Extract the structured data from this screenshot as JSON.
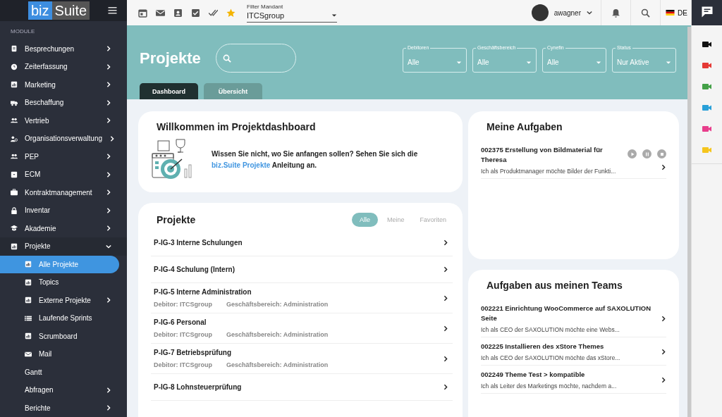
{
  "logo": {
    "part1": "biz",
    "part2": "Suite"
  },
  "sidebar": {
    "section": "MODULE",
    "items": [
      {
        "label": "Besprechungen",
        "expanded": false
      },
      {
        "label": "Zeiterfassung",
        "expanded": false
      },
      {
        "label": "Marketing",
        "expanded": false
      },
      {
        "label": "Beschaffung",
        "expanded": false
      },
      {
        "label": "Vertrieb",
        "expanded": false
      },
      {
        "label": "Organisationsverwaltung",
        "expanded": false
      },
      {
        "label": "PEP",
        "expanded": false
      },
      {
        "label": "ECM",
        "expanded": false
      },
      {
        "label": "Kontraktmanagement",
        "expanded": false
      },
      {
        "label": "Inventar",
        "expanded": false
      },
      {
        "label": "Akademie",
        "expanded": false
      },
      {
        "label": "Projekte",
        "expanded": true,
        "children": [
          {
            "label": "Alle Projekte",
            "selected": true
          },
          {
            "label": "Topics",
            "selected": false
          },
          {
            "label": "Externe Projekte",
            "selected": false,
            "expanded": false
          },
          {
            "label": "Laufende Sprints",
            "selected": false
          },
          {
            "label": "Scrumboard",
            "selected": false
          },
          {
            "label": "Mail",
            "selected": false
          }
        ]
      },
      {
        "label": "Gantt"
      },
      {
        "label": "Abfragen",
        "expanded": false
      },
      {
        "label": "Berichte",
        "expanded": false
      }
    ]
  },
  "topbar": {
    "filter": {
      "label": "Filter Mandant",
      "value": "ITCSgroup"
    },
    "user": "awagner",
    "language": "DE"
  },
  "header": {
    "title": "Projekte",
    "filters": [
      {
        "label": "Debitoren",
        "value": "Alle"
      },
      {
        "label": "Geschäftsbereich",
        "value": "Alle"
      },
      {
        "label": "Cynefin",
        "value": "Alle"
      },
      {
        "label": "Status",
        "value": "Nur Aktive"
      }
    ],
    "tabs": [
      {
        "label": "Dashboard",
        "selected": true
      },
      {
        "label": "Übersicht",
        "selected": false
      }
    ]
  },
  "welcome": {
    "title": "Willkommen im Projektdashboard",
    "text_before": "Wissen Sie nicht, wo Sie anfangen sollen? Sehen Sie sich die ",
    "link": "biz.Suite Projekte",
    "text_after": " Anleitung an."
  },
  "projects": {
    "title": "Projekte",
    "filters": [
      {
        "label": "Alle",
        "selected": true
      },
      {
        "label": "Meine",
        "selected": false
      },
      {
        "label": "Favoriten",
        "selected": false
      }
    ],
    "rows": [
      {
        "name": "P-IG-3 Interne Schulungen"
      },
      {
        "name": "P-IG-4 Schulung (Intern)"
      },
      {
        "name": "P-IG-5 Interne Administration",
        "debitor": "Debitor: ITCSgroup",
        "area": "Geschäftsbereich: Administration"
      },
      {
        "name": "P-IG-6 Personal",
        "debitor": "Debitor: ITCSgroup",
        "area": "Geschäftsbereich: Administration"
      },
      {
        "name": "P-IG-7 Betriebsprüfung",
        "debitor": "Debitor: ITCSgroup",
        "area": "Geschäftsbereich: Administration"
      },
      {
        "name": "P-IG-8 Lohnsteuerprüfung"
      }
    ]
  },
  "my_tasks": {
    "title": "Meine Aufgaben",
    "items": [
      {
        "title": "002375 Erstellung von Bildmaterial für Theresa",
        "description": "Ich als Produktmanager möchte Bilder der Funkti...",
        "timer": true
      }
    ]
  },
  "team_tasks": {
    "title": "Aufgaben aus meinen Teams",
    "items": [
      {
        "title": "002221 Einrichtung WooCommerce auf SAXOLUTION Seite",
        "description": "Ich als CEO der SAXOLUTION möchte eine Webs...",
        "timer": false
      },
      {
        "title": "002225 Installieren des xStore Themes",
        "description": "Ich als CEO der SAXOLUTION möchte das xStore...",
        "timer": false
      },
      {
        "title": "002249 Theme Test > kompatible",
        "description": "Ich als Leiter des Marketings möchte, nachdem a...",
        "timer": false
      }
    ]
  },
  "right_rail": {
    "video_buttons": [
      {
        "color": "#111111"
      },
      {
        "color": "#e53935"
      },
      {
        "color": "#43a047"
      },
      {
        "color": "#29a0d8"
      },
      {
        "color": "#e83e8c"
      },
      {
        "color": "#f5c51d"
      }
    ]
  }
}
